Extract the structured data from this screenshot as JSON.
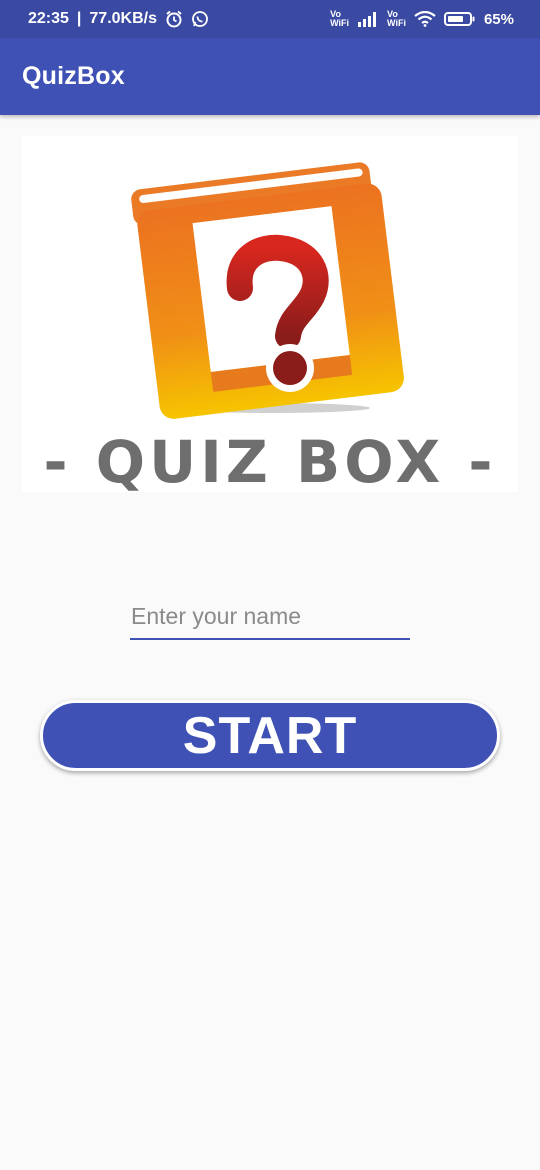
{
  "status_bar": {
    "time": "22:35",
    "network_speed": "77.0KB/s",
    "vowifi_1_top": "Vo",
    "vowifi_1_bottom": "WiFi",
    "vowifi_2_top": "Vo",
    "vowifi_2_bottom": "WiFi",
    "battery_percent": "65%",
    "icons": [
      "alarm-icon",
      "whatsapp-icon",
      "signal-icon",
      "wifi-icon",
      "battery-icon"
    ]
  },
  "app_bar": {
    "title": "QuizBox"
  },
  "logo": {
    "text": "- QUIZ BOX -",
    "symbol": "?"
  },
  "form": {
    "name_placeholder": "Enter your name",
    "name_value": ""
  },
  "actions": {
    "start_label": "START"
  },
  "colors": {
    "primary": "#3f51b5",
    "primary_dark": "#3a4aa3",
    "background": "#fafafa"
  }
}
